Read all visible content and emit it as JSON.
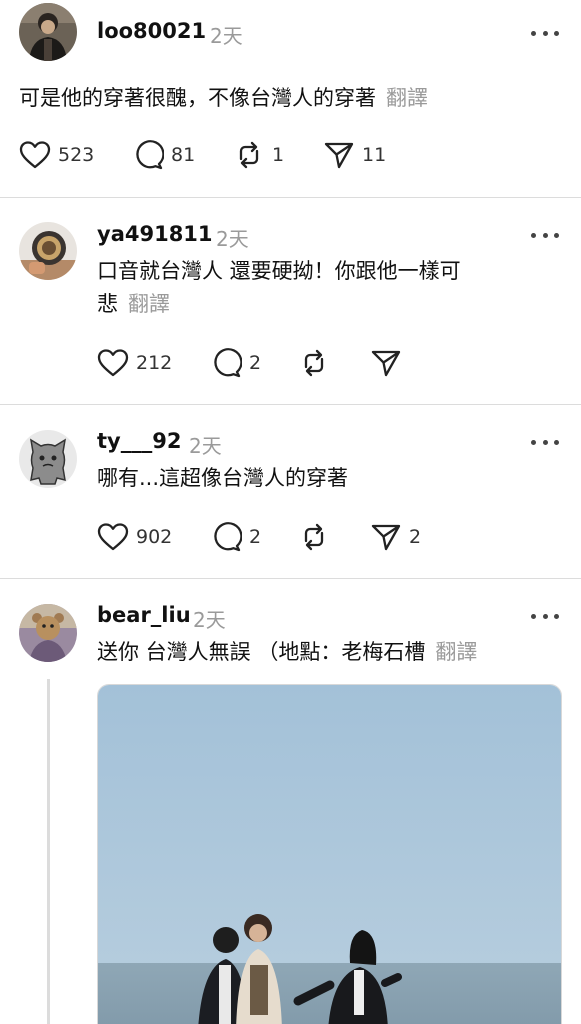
{
  "posts": [
    {
      "username": "loo80021",
      "time": "2天",
      "text_lines": [
        "可是他的穿著很醜，不像台灣人的穿著"
      ],
      "translate": "翻譯",
      "likes": "523",
      "replies": "81",
      "reposts": "1",
      "shares": "11"
    },
    {
      "username": "ya491811",
      "time": "2天",
      "text_lines": [
        "口音就台灣人 還要硬拗！你跟他一樣可",
        "悲"
      ],
      "translate": "翻譯",
      "likes": "212",
      "replies": "2",
      "reposts": "",
      "shares": ""
    },
    {
      "username": "ty___92",
      "time": "2天",
      "text_lines": [
        "哪有...這超像台灣人的穿著"
      ],
      "likes": "902",
      "replies": "2",
      "reposts": "",
      "shares": "2"
    },
    {
      "username": "bear_liu",
      "time": "2天",
      "text_lines": [
        "送你 台灣人無誤 （地點：老梅石槽"
      ],
      "translate": "翻譯"
    }
  ],
  "icons": {
    "like": "heart-icon",
    "reply": "comment-icon",
    "repost": "repost-icon",
    "share": "send-icon",
    "more": "more-options-icon"
  },
  "colors": {
    "text": "#111111",
    "muted": "#9a9a9a",
    "divider": "#dcdcdc"
  }
}
